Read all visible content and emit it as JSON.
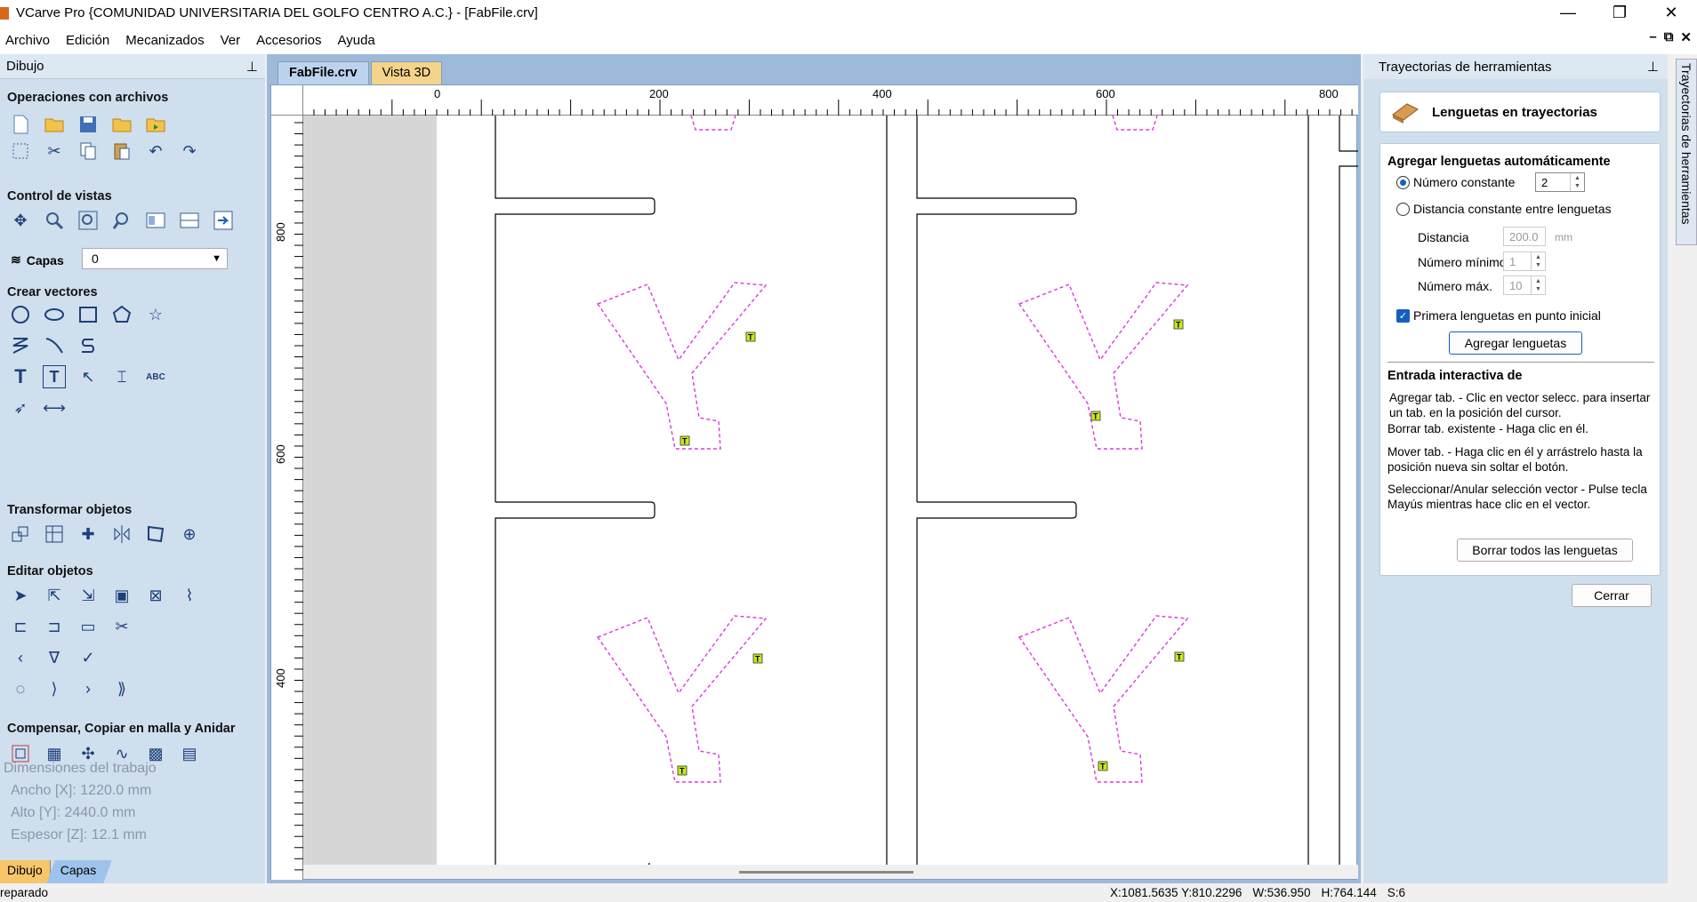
{
  "window": {
    "title": "VCarve Pro {COMUNIDAD UNIVERSITARIA DEL GOLFO CENTRO  A.C.} - [FabFile.crv]",
    "minimize": "—",
    "restore": "❐",
    "close": "✕"
  },
  "menu": {
    "items": [
      "Archivo",
      "Edición",
      "Mecanizados",
      "Ver",
      "Accesorios",
      "Ayuda"
    ],
    "mdi_controls": [
      "–",
      "⧉",
      "✕"
    ]
  },
  "left_panel": {
    "title": "Dibujo",
    "pin": "⊥",
    "sections": {
      "file_ops": "Operaciones con archivos",
      "view_control": "Control de vistas",
      "create_vectors": "Crear vectores",
      "transform": "Transformar objetos",
      "edit": "Editar objetos",
      "offset": "Compensar, Copiar en malla y Anidar"
    },
    "layers_label": "Capas",
    "layer_value": "0",
    "job": {
      "title": "Dimensiones del trabajo",
      "width": "Ancho   [X]: 1220.0 mm",
      "height": "Alto    [Y]: 2440.0 mm",
      "thickness": "Espesor [Z]: 12.1 mm"
    },
    "bottom_tabs": [
      "Dibujo",
      "Capas"
    ]
  },
  "document": {
    "tabs": [
      "FabFile.crv",
      "Vista 3D"
    ],
    "hruler_labels": [
      "0",
      "200",
      "400",
      "600",
      "800"
    ],
    "vruler_labels": [
      "800",
      "600",
      "400"
    ],
    "tab_marker": "T"
  },
  "right_panel": {
    "title": "Trayectorias de herramientas",
    "pin": "⊥",
    "heading": "Lenguetas en trayectorias",
    "auto_title": "Agregar lenguetas automáticamente",
    "radio_constant": "Número constante",
    "constant_value": "2",
    "radio_distance": "Distancia constante entre lenguetas",
    "distance_label": "Distancia",
    "distance_value": "200.0",
    "distance_unit": "mm",
    "min_label": "Número mínimo",
    "min_value": "1",
    "max_label": "Número máx.",
    "max_value": "10",
    "first_tab_label": "Primera lenguetas en punto inicial",
    "add_button": "Agregar lenguetas",
    "interactive_title": "Entrada interactiva de",
    "help1": "Agregar tab. - Clic en vector selecc. para insertar un tab. en la posición del cursor.",
    "help2": "Borrar tab. existente - Haga clic en él.",
    "help3": "Mover tab. - Haga clic en él y arrástrelo hasta la posición nueva sin soltar el botón.",
    "help4": "Seleccionar/Anular selección vector - Pulse tecla Mayús mientras hace clic en el vector.",
    "delete_all_button": "Borrar todos las lenguetas",
    "close_button": "Cerrar",
    "vertical_tab": "Trayectorias de herramientas"
  },
  "status": {
    "left": "reparado",
    "coords": "X:1081.5635 Y:810.2296",
    "width": "W:536.950",
    "height": "H:764.144",
    "s": "S:6"
  },
  "colors": {
    "panel_bg": "#cfdfee",
    "accent": "#1560bd",
    "vector_dash": "#d83bd8",
    "tab_marker": "#c7e81a"
  }
}
